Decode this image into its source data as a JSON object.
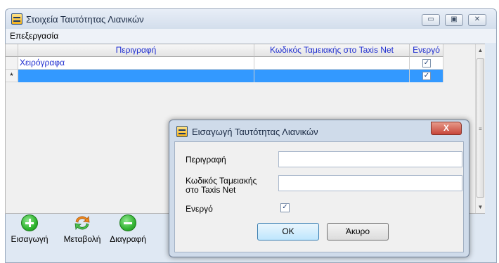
{
  "window": {
    "title": "Στοιχεία Ταυτότητας Λιανικών",
    "min_glyph": "▭",
    "max_glyph": "▣",
    "close_glyph": "✕"
  },
  "menu": {
    "edit": "Επεξεργασία"
  },
  "grid": {
    "columns": [
      "Περιγραφή",
      "Κωδικός Ταμειακής στο Taxis Net",
      "Ενεργό"
    ],
    "rows": [
      {
        "indicator": "",
        "description": "Χειρόγραφα",
        "code": "",
        "active": true
      },
      {
        "indicator": "*",
        "description": "",
        "code": "",
        "active": true
      }
    ]
  },
  "toolbar": {
    "insert_label": "Εισαγωγή",
    "modify_label": "Μεταβολή",
    "delete_label": "Διαγραφή"
  },
  "dialog": {
    "title": "Εισαγωγή Ταυτότητας Λιανικών",
    "close_glyph": "X",
    "fields": {
      "description_label": "Περιγραφή",
      "description_value": "",
      "code_label_line1": "Κωδικός Ταμειακής",
      "code_label_line2": "στο Taxis Net",
      "code_value": "",
      "active_label": "Ενεργό",
      "active_checked": true
    },
    "ok_label": "OK",
    "cancel_label": "Άκυρο"
  },
  "colors": {
    "selection": "#3399ff",
    "header_text": "#1f2ed0",
    "link_text": "#1f2ed0",
    "add_green": "#2fb52f",
    "delete_green": "#34b434",
    "modify_orange": "#f08a1c"
  },
  "icons": {
    "window": "form-icon",
    "insert": "plus-circle-icon",
    "modify": "refresh-arrows-icon",
    "delete": "minus-circle-icon",
    "check": "check-icon"
  }
}
